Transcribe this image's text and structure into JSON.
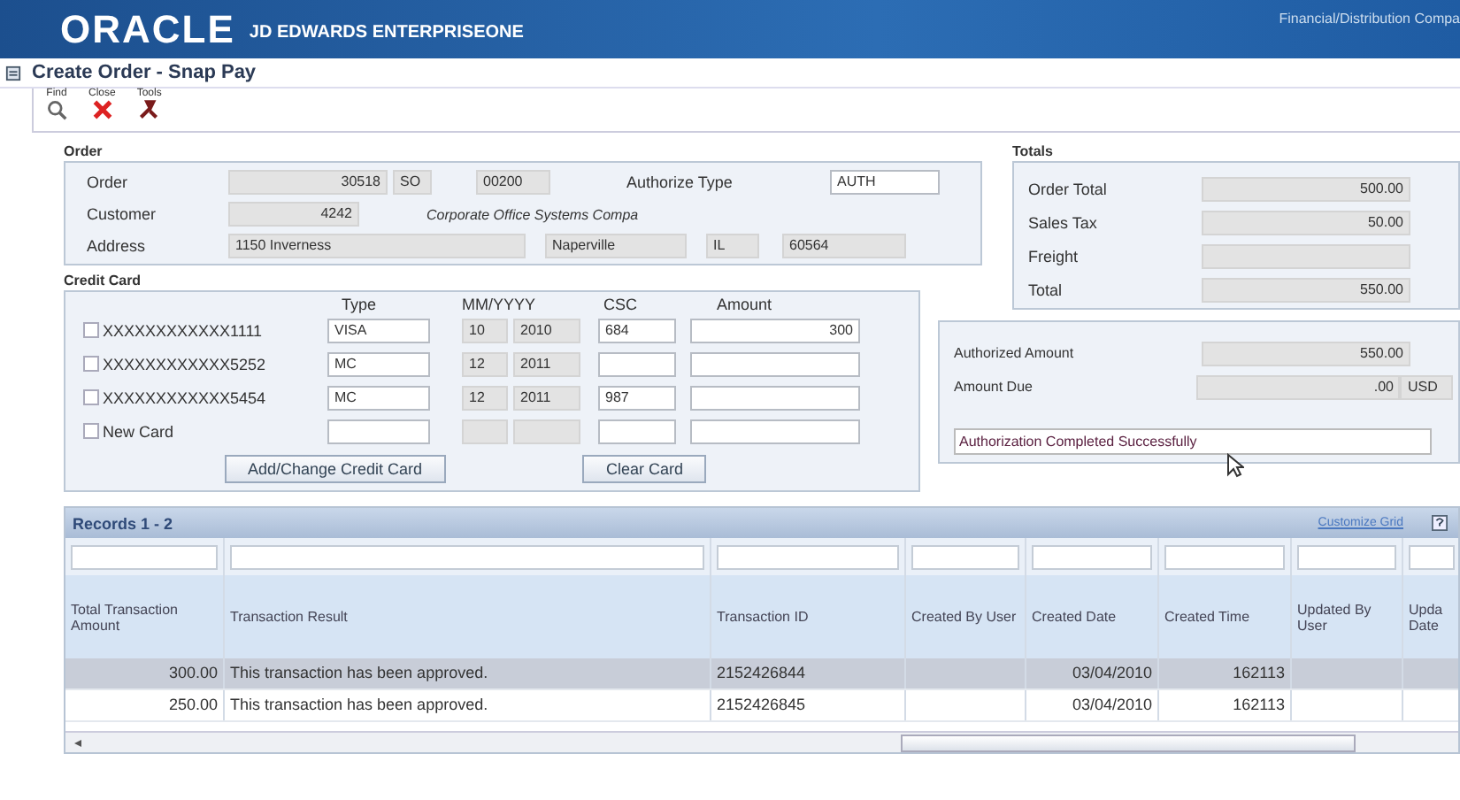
{
  "banner": {
    "logo": "ORACLE",
    "product": "JD EDWARDS ENTERPRISEONE",
    "company": "Financial/Distribution Compa"
  },
  "window": {
    "title": "Create Order - Snap Pay"
  },
  "toolbar": [
    {
      "label": "Find",
      "kind": "find"
    },
    {
      "label": "Close",
      "kind": "close"
    },
    {
      "label": "Tools",
      "kind": "tools"
    }
  ],
  "order": {
    "title": "Order",
    "order_no": "30518",
    "order_type": "SO",
    "company": "00200",
    "authorize_type_label": "Authorize Type",
    "authorize_type": "AUTH",
    "customer_label": "Customer",
    "customer_no": "4242",
    "customer_name": "Corporate Office Systems Compa",
    "order_label": "Order",
    "address_label": "Address",
    "street": "1150 Inverness",
    "city": "Naperville",
    "state": "IL",
    "zip": "60564"
  },
  "totals": {
    "title": "Totals",
    "rows": [
      {
        "label": "Order Total",
        "value": "500.00"
      },
      {
        "label": "Sales Tax",
        "value": "50.00"
      },
      {
        "label": "Freight"
      },
      {
        "label": "Total",
        "value": "550.00"
      }
    ]
  },
  "credit_card": {
    "title": "Credit Card",
    "columns": [
      "Type",
      "MM/YYYY",
      "CSC",
      "Amount"
    ],
    "cards": [
      {
        "label": "XXXXXXXXXXXX1111",
        "checked": false,
        "type": "VISA",
        "month": "10",
        "year": "2010",
        "csc": "684",
        "amount": "300"
      },
      {
        "label": "XXXXXXXXXXXX5252",
        "checked": false,
        "type": "MC",
        "month": "12",
        "year": "2011"
      },
      {
        "label": "XXXXXXXXXXXX5454",
        "checked": false,
        "type": "MC",
        "month": "12",
        "year": "2011",
        "csc": "987"
      },
      {
        "label": "New Card",
        "checked": false
      }
    ],
    "buttons": [
      "Add/Change Credit Card",
      "Clear Card"
    ]
  },
  "authorization": {
    "authorized_label": "Authorized Amount",
    "authorized": "550.00",
    "due_label": "Amount Due",
    "due": ".00",
    "currency": "USD",
    "message": "Authorization Completed Successfully"
  },
  "grid": {
    "title": "Records 1 - 2",
    "customize": "Customize Grid",
    "columns": [
      "Total Transaction Amount",
      "Transaction Result",
      "Transaction ID",
      "Created By User",
      "Created Date",
      "Created Time",
      "Updated By User",
      "Upda Date"
    ],
    "rows": [
      {
        "selected": true,
        "cells": [
          "300.00",
          "This transaction has been approved.",
          "2152426844",
          null,
          "03/04/2010",
          "162113",
          null,
          null
        ]
      },
      {
        "selected": false,
        "cells": [
          "250.00",
          "This transaction has been approved.",
          "2152426845",
          null,
          "03/04/2010",
          "162113",
          null,
          null
        ]
      }
    ]
  }
}
